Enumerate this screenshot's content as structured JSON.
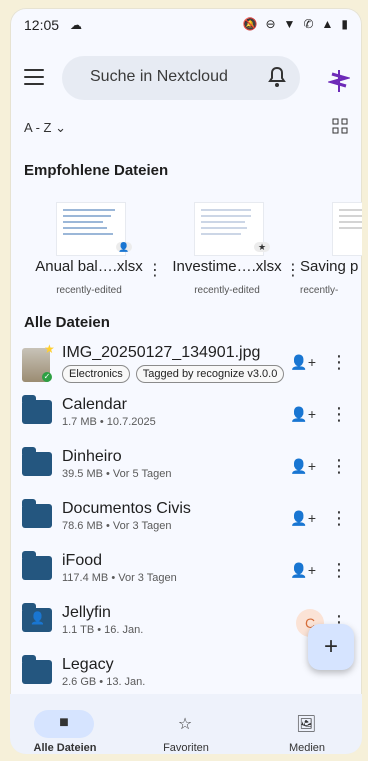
{
  "status_bar": {
    "time": "12:05",
    "left_icon": "cloud-icon",
    "right_icons": [
      "mute-icon",
      "dnd-icon",
      "wifi-icon",
      "call-icon",
      "signal-icon",
      "battery-icon"
    ]
  },
  "search": {
    "placeholder": "Suche in Nextcloud",
    "menu_icon": "menu-icon",
    "bell_icon": "bell-icon",
    "logo_icon": "nextcloud-logo-icon"
  },
  "sort": {
    "label": "A - Z",
    "grid_icon": "grid-view-icon"
  },
  "recommended": {
    "title": "Empfohlene Dateien",
    "items": [
      {
        "name": "Anual bal….xlsx",
        "meta": "recently-edited"
      },
      {
        "name": "Investime….xlsx",
        "meta": "recently-edited"
      },
      {
        "name": "Saving p",
        "meta": "recently-"
      }
    ]
  },
  "files": {
    "title": "Alle Dateien",
    "rows": [
      {
        "type": "image",
        "title": "IMG_20250127_134901.jpg",
        "tags": [
          "Electronics",
          "Tagged by recognize v3.0.0"
        ],
        "share_icon": "share-user-icon",
        "more_icon": "more-vert-icon"
      },
      {
        "type": "folder",
        "title": "Calendar",
        "subtitle": "1.7 MB • 10.7.2025",
        "share_icon": "share-user-icon",
        "more_icon": "more-vert-icon"
      },
      {
        "type": "folder",
        "title": "Dinheiro",
        "subtitle": "39.5 MB • Vor 5 Tagen",
        "share_icon": "share-user-icon",
        "more_icon": "more-vert-icon"
      },
      {
        "type": "folder",
        "title": "Documentos Civis",
        "subtitle": "78.6 MB • Vor 3 Tagen",
        "share_icon": "share-user-icon",
        "more_icon": "more-vert-icon"
      },
      {
        "type": "folder",
        "title": "iFood",
        "subtitle": "117.4 MB • Vor 3 Tagen",
        "share_icon": "share-user-icon",
        "more_icon": "more-vert-icon"
      },
      {
        "type": "shared-folder",
        "title": "Jellyfin",
        "subtitle": "1.1 TB • 16. Jan.",
        "avatar": "C",
        "more_icon": "more-vert-icon"
      },
      {
        "type": "folder",
        "title": "Legacy",
        "subtitle": "2.6 GB • 13. Jan."
      }
    ]
  },
  "fab": {
    "label": "+"
  },
  "bottom_nav": [
    {
      "label": "Alle Dateien",
      "icon": "folder-icon",
      "active": true
    },
    {
      "label": "Favoriten",
      "icon": "star-icon",
      "active": false
    },
    {
      "label": "Medien",
      "icon": "image-icon",
      "active": false
    }
  ]
}
